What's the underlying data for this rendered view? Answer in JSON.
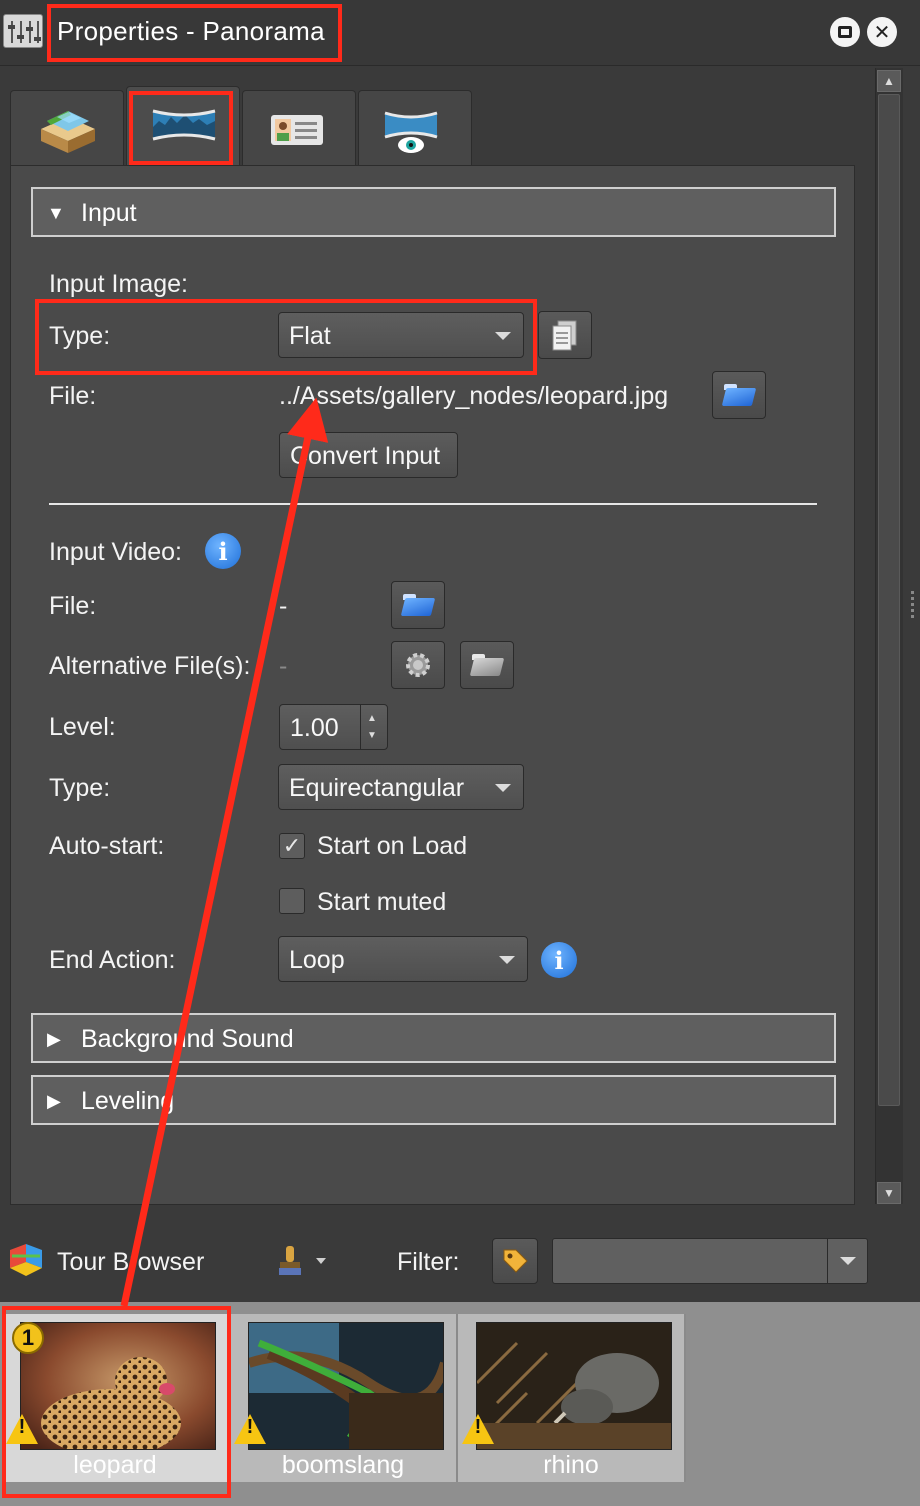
{
  "window": {
    "title": "Properties - Panorama"
  },
  "tabs": [
    {
      "name": "tab-tour"
    },
    {
      "name": "tab-panorama"
    },
    {
      "name": "tab-user-data"
    },
    {
      "name": "tab-viewing-parameters"
    }
  ],
  "input_section": {
    "header": "Input",
    "image": {
      "heading": "Input Image:",
      "type_label": "Type:",
      "type_value": "Flat",
      "file_label": "File:",
      "file_value": "../Assets/gallery_nodes/leopard.jpg",
      "convert_button": "Convert Input"
    },
    "video": {
      "heading": "Input Video:",
      "file_label": "File:",
      "file_value": "-",
      "alt_label": "Alternative File(s):",
      "alt_value": "-",
      "level_label": "Level:",
      "level_value": "1.00",
      "type_label": "Type:",
      "type_value": "Equirectangular",
      "autostart_label": "Auto-start:",
      "start_on_load": "Start on Load",
      "start_on_load_checked": true,
      "start_muted": "Start muted",
      "start_muted_checked": false,
      "end_action_label": "End Action:",
      "end_action_value": "Loop"
    }
  },
  "sections": {
    "background_sound": "Background Sound",
    "leveling": "Leveling"
  },
  "tour_browser": {
    "title": "Tour Browser",
    "filter_label": "Filter:",
    "filter_value": "",
    "nodes": [
      {
        "name": "leopard",
        "badge": "1",
        "selected": true
      },
      {
        "name": "boomslang",
        "badge": "",
        "selected": false
      },
      {
        "name": "rhino",
        "badge": "",
        "selected": false
      }
    ]
  },
  "colors": {
    "annotation_red": "#ff2a1a",
    "panel_bg": "#4a4a4a",
    "info_blue": "#1e6fd8",
    "warning_yellow": "#f7c512"
  }
}
